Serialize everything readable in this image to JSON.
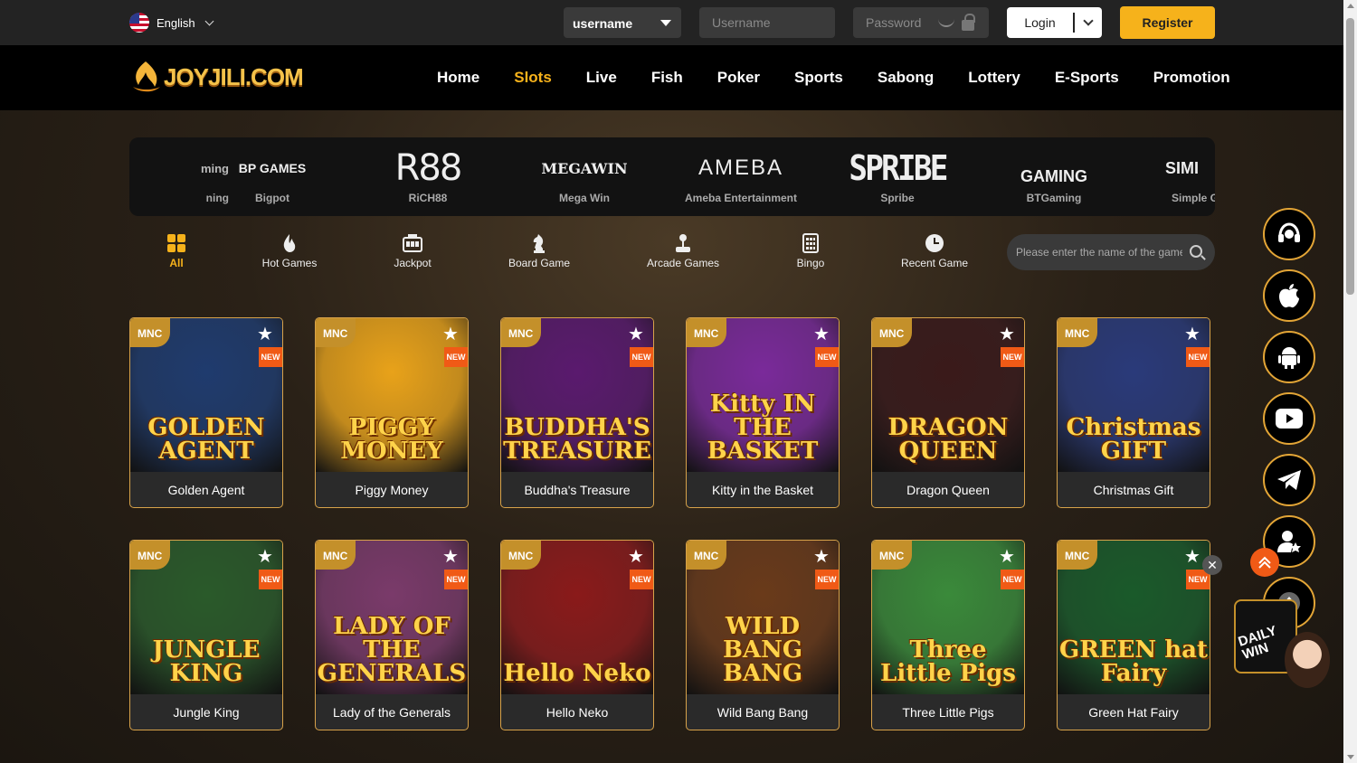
{
  "header": {
    "language": "English",
    "login_type": "username",
    "username_placeholder": "Username",
    "password_placeholder": "Password",
    "login_label": "Login",
    "register_label": "Register"
  },
  "brand": {
    "logo_text": "JOYJILI.COM",
    "accent": "#f6b21b"
  },
  "nav": [
    "Home",
    "Slots",
    "Live",
    "Fish",
    "Poker",
    "Sports",
    "Sabong",
    "Lottery",
    "E-Sports",
    "Promotion"
  ],
  "nav_active": "Slots",
  "providers": [
    {
      "logo": "ming",
      "name": "ning"
    },
    {
      "logo": "BP GAMES",
      "name": "Bigpot"
    },
    {
      "logo": "R88",
      "name": "RiCH88"
    },
    {
      "logo": "MEGAWIN",
      "name": "Mega Win"
    },
    {
      "logo": "AMEBA",
      "name": "Ameba Entertainment"
    },
    {
      "logo": "SPRIBE",
      "name": "Spribe"
    },
    {
      "logo": "GAMING",
      "name": "BTGaming"
    },
    {
      "logo": "SIMI",
      "name": "Simple G"
    }
  ],
  "categories": [
    {
      "label": "All",
      "icon": "grid-icon",
      "active": true
    },
    {
      "label": "Hot Games",
      "icon": "flame-icon"
    },
    {
      "label": "Jackpot",
      "icon": "jackpot-icon"
    },
    {
      "label": "Board Game",
      "icon": "chess-knight-icon"
    },
    {
      "label": "Arcade Games",
      "icon": "joystick-icon"
    },
    {
      "label": "Bingo",
      "icon": "bingo-card-icon"
    },
    {
      "label": "Recent Game",
      "icon": "clock-icon"
    }
  ],
  "search_placeholder": "Please enter the name of the game",
  "game_badges": {
    "provider": "MNC",
    "new": "NEW"
  },
  "games": [
    {
      "name": "Golden Agent",
      "art": "GOLDEN AGENT",
      "bg": "#1f3b6e"
    },
    {
      "name": "Piggy Money",
      "art": "PIGGY MONEY",
      "bg": "#e8a21a"
    },
    {
      "name": "Buddha's Treasure",
      "art": "BUDDHA'S TREASURE",
      "bg": "#5a1a6e"
    },
    {
      "name": "Kitty in the Basket",
      "art": "Kitty IN THE BASKET",
      "bg": "#7a2a9a"
    },
    {
      "name": "Dragon Queen",
      "art": "DRAGON QUEEN",
      "bg": "#3a1a1a"
    },
    {
      "name": "Christmas Gift",
      "art": "Christmas GIFT",
      "bg": "#2a3a7a"
    },
    {
      "name": "Jungle King",
      "art": "JUNGLE KING",
      "bg": "#2a5a2a"
    },
    {
      "name": "Lady of the Generals",
      "art": "LADY OF THE GENERALS",
      "bg": "#7a3a6a"
    },
    {
      "name": "Hello Neko",
      "art": "Hello Neko",
      "bg": "#8a1a1a"
    },
    {
      "name": "Wild Bang Bang",
      "art": "WILD BANG BANG",
      "bg": "#6a3a1a"
    },
    {
      "name": "Three Little Pigs",
      "art": "Three Little Pigs",
      "bg": "#3a8a3a"
    },
    {
      "name": "Green Hat Fairy",
      "art": "GREEN hat Fairy",
      "bg": "#1a5a2a"
    }
  ],
  "floating": [
    {
      "icon": "headset-icon"
    },
    {
      "icon": "apple-icon"
    },
    {
      "icon": "android-icon"
    },
    {
      "icon": "youtube-icon"
    },
    {
      "icon": "telegram-icon"
    },
    {
      "icon": "user-star-icon"
    },
    {
      "icon": "arrow-up-icon"
    }
  ],
  "daily_win": "DAILY WIN"
}
